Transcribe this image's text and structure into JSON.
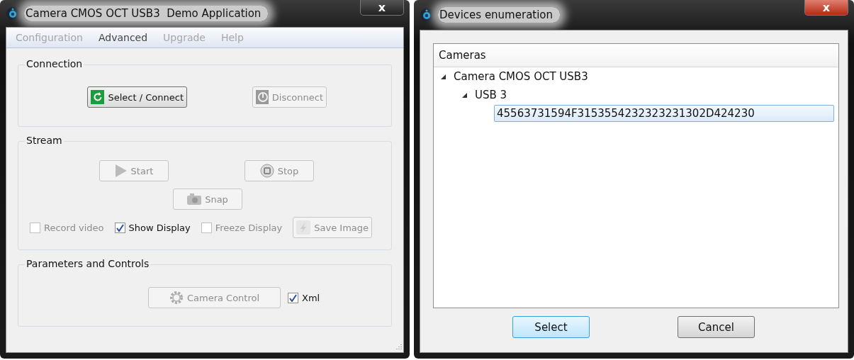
{
  "main_window": {
    "title": "Camera CMOS OCT USB3  Demo Application",
    "close": "x",
    "menu": [
      {
        "label": "Configuration",
        "disabled": true
      },
      {
        "label": "Advanced",
        "disabled": false
      },
      {
        "label": "Upgrade",
        "disabled": true
      },
      {
        "label": "Help",
        "disabled": true
      }
    ],
    "connection": {
      "title": "Connection",
      "select_connect": {
        "label": "Select / Connect",
        "disabled": false
      },
      "disconnect": {
        "label": "Disconnect",
        "disabled": true
      }
    },
    "stream": {
      "title": "Stream",
      "start": {
        "label": "Start",
        "disabled": true
      },
      "stop": {
        "label": "Stop",
        "disabled": true
      },
      "snap": {
        "label": "Snap",
        "disabled": true
      },
      "checkboxes": [
        {
          "label": "Record video",
          "checked": false,
          "disabled": true
        },
        {
          "label": "Show Display",
          "checked": true,
          "disabled": false
        },
        {
          "label": "Freeze Display",
          "checked": false,
          "disabled": true
        }
      ],
      "save_image": {
        "label": "Save Image",
        "disabled": true
      }
    },
    "parameters": {
      "title": "Parameters and Controls",
      "camera_control": {
        "label": "Camera Control",
        "disabled": true
      },
      "xml": {
        "label": "Xml",
        "checked": true,
        "disabled": false
      }
    }
  },
  "dialog": {
    "title": "Devices enumeration",
    "close": "x",
    "tree_header": "Cameras",
    "tree": [
      {
        "label": "Camera CMOS OCT USB3",
        "expanded": true,
        "selected": false,
        "children": [
          {
            "label": "USB 3",
            "expanded": true,
            "selected": false,
            "children": [
              {
                "label": "45563731594F3153554232323231302D424230",
                "selected": true
              }
            ]
          }
        ]
      }
    ],
    "buttons": [
      {
        "label": "Select",
        "focused": true
      },
      {
        "label": "Cancel",
        "focused": false
      }
    ]
  }
}
